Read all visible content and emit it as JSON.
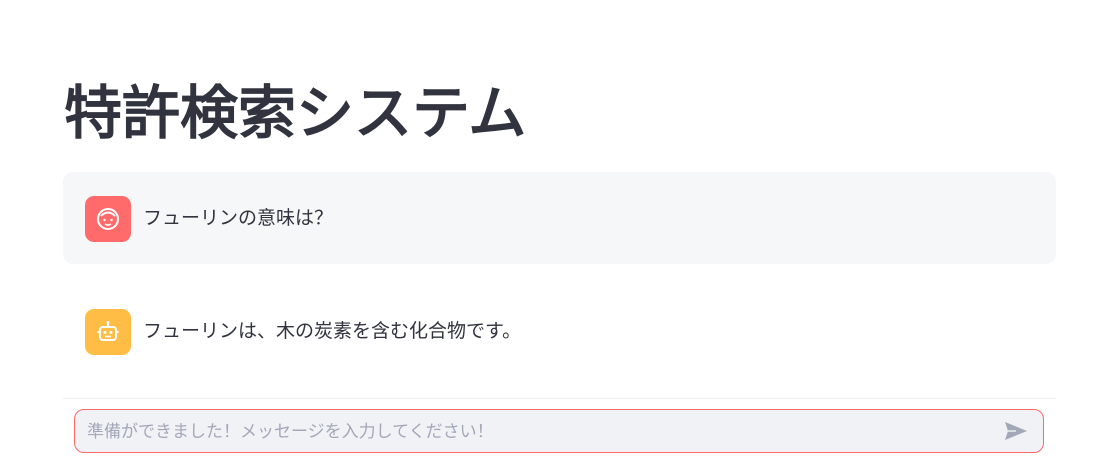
{
  "header": {
    "title": "特許検索システム"
  },
  "messages": [
    {
      "role": "user",
      "avatar_icon": "face-icon",
      "avatar_color": "#ff6b6b",
      "text": "フューリンの意味は？"
    },
    {
      "role": "assistant",
      "avatar_icon": "robot-icon",
      "avatar_color": "#ffbd45",
      "text": "フューリンは、木の炭素を含む化合物です。"
    }
  ],
  "chat_input": {
    "value": "",
    "placeholder": "準備ができました！メッセージを入力してください！",
    "border_color": "#ff6b6b",
    "send_icon": "send-icon"
  }
}
